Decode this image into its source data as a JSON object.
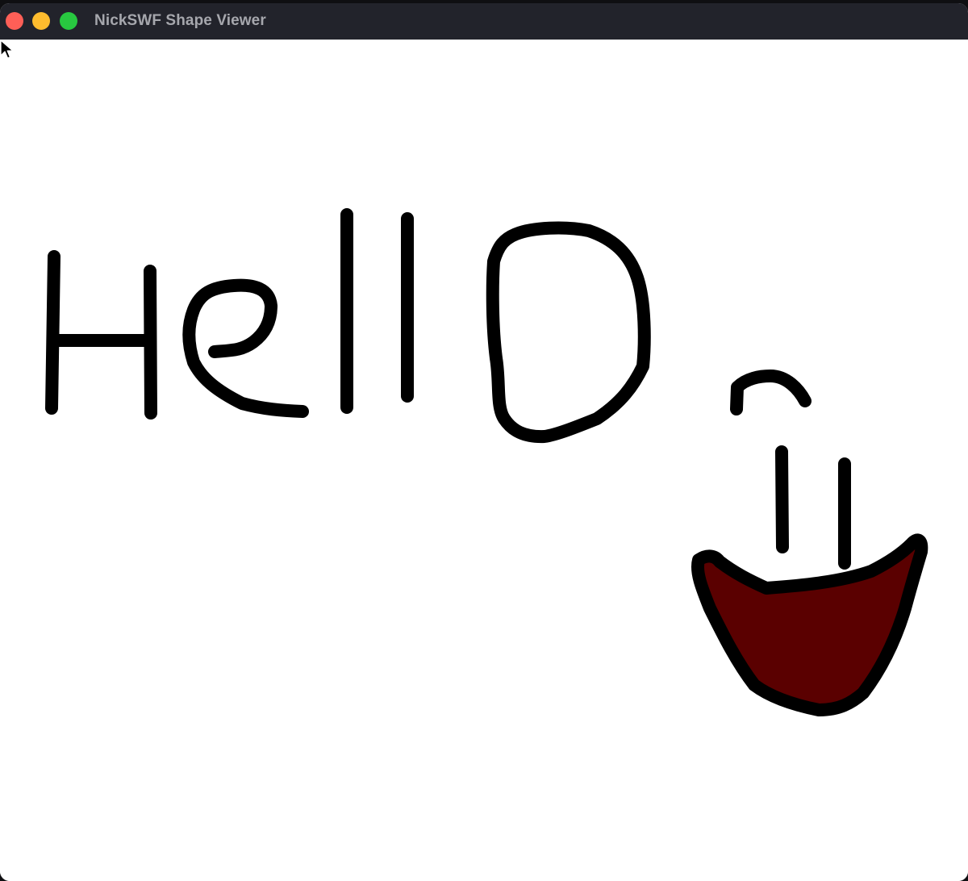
{
  "window": {
    "title": "NickSWF Shape Viewer"
  },
  "drawing": {
    "stroke_color": "#000000",
    "fill_color": "#5a0000",
    "background": "#ffffff"
  },
  "icons": {
    "close": "close-icon",
    "minimize": "minimize-icon",
    "zoom": "zoom-icon",
    "cursor": "mouse-pointer-icon"
  }
}
